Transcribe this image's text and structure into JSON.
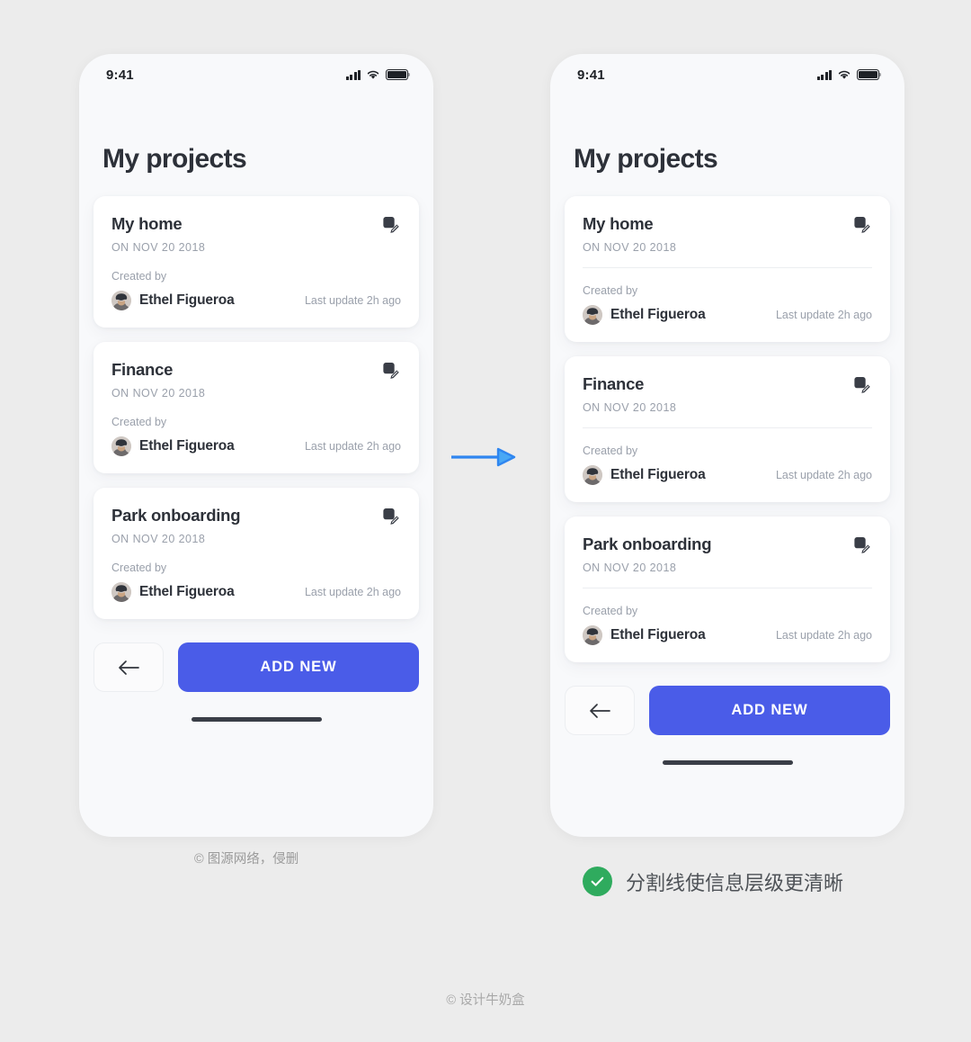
{
  "colors": {
    "page_background": "#ececec",
    "phone_screen": "#f8f9fb",
    "card": "#ffffff",
    "primary_button": "#4a5ce8",
    "text_dark": "#2d3139",
    "text_muted": "#9aa0ab",
    "divider": "#eceef1",
    "ok_badge": "#2fab5e",
    "arrow": "#2f86f0"
  },
  "status_bar": {
    "time": "9:41",
    "signal_icon": "cellular-signal-icon",
    "wifi_icon": "wifi-icon",
    "battery_icon": "battery-full-icon"
  },
  "screen": {
    "title": "My projects"
  },
  "labels": {
    "created_by": "Created by",
    "edit_icon": "edit-pencil-icon",
    "avatar": "user-avatar"
  },
  "projects": [
    {
      "title": "My home",
      "date": "ON NOV 20 2018",
      "author": "Ethel Figueroa",
      "last_update": "Last update 2h ago"
    },
    {
      "title": "Finance",
      "date": "ON NOV 20 2018",
      "author": "Ethel Figueroa",
      "last_update": "Last update 2h ago"
    },
    {
      "title": "Park onboarding",
      "date": "ON NOV 20 2018",
      "author": "Ethel Figueroa",
      "last_update": "Last update 2h ago"
    }
  ],
  "bottom_bar": {
    "back_icon": "arrow-left-icon",
    "add_label": "ADD NEW"
  },
  "annotations": {
    "left_caption": "© 图源网络，侵删",
    "ok_note": "分割线使信息层级更清晰",
    "ok_icon": "check-circle-icon",
    "flow_arrow_icon": "arrow-right-icon",
    "footer": "© 设计牛奶盒"
  }
}
